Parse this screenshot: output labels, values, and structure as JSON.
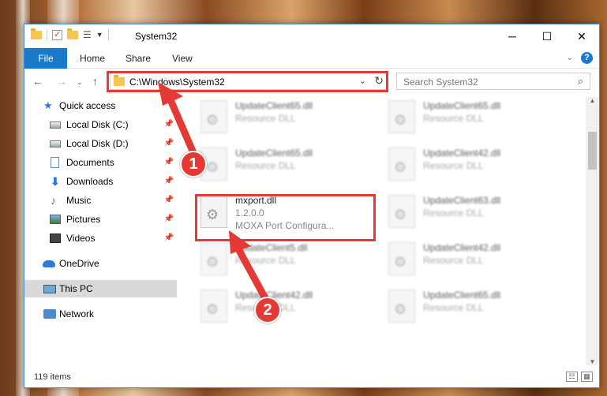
{
  "window": {
    "title": "System32",
    "controls": {
      "minimize": "─",
      "maximize": "☐",
      "close": "✕"
    }
  },
  "ribbon": {
    "file": "File",
    "tabs": [
      "Home",
      "Share",
      "View"
    ]
  },
  "address": {
    "path": "C:\\Windows\\System32",
    "search_placeholder": "Search System32"
  },
  "sidebar": {
    "quick_access": "Quick access",
    "items": [
      "Local Disk (C:)",
      "Local Disk (D:)",
      "Documents",
      "Downloads",
      "Music",
      "Pictures",
      "Videos"
    ],
    "onedrive": "OneDrive",
    "this_pc": "This PC",
    "network": "Network"
  },
  "files": [
    {
      "name": "UpdateClient65.dll",
      "type": "Resource DLL"
    },
    {
      "name": "UpdateClient65.dll",
      "type": "Resource DLL"
    },
    {
      "name": "UpdateClient65.dll",
      "type": "Resource DLL"
    },
    {
      "name": "UpdateClient42.dll",
      "type": "Resource DLL"
    },
    {
      "name": "mxport.dll",
      "version": "1.2.0.0",
      "description": "MOXA Port Configura..."
    },
    {
      "name": "UpdateClient63.dll",
      "type": "Resource DLL"
    },
    {
      "name": "UpdateClient5.dll",
      "type": "Resource DLL"
    },
    {
      "name": "UpdateClient42.dll",
      "type": "Resource DLL"
    },
    {
      "name": "UpdateClient42.dll",
      "type": "Resource DLL"
    },
    {
      "name": "UpdateClient65.dll",
      "type": "Resource DLL"
    }
  ],
  "status": {
    "count": "119 items"
  },
  "annotations": {
    "step1": "1",
    "step2": "2"
  },
  "colors": {
    "accent": "#1979ca",
    "highlight": "#e53935"
  }
}
